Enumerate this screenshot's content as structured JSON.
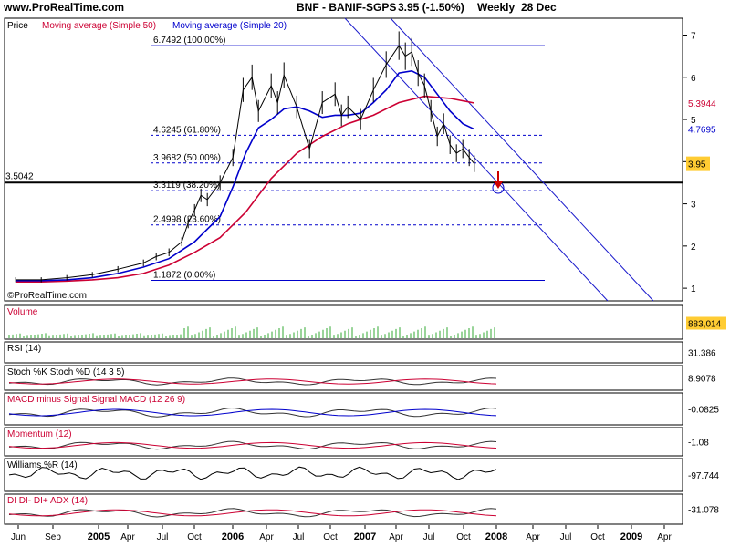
{
  "header": {
    "site": "www.ProRealTime.com",
    "instrument": "BNF - BANIF-SGPS",
    "quote": "3.95 (-1.50%)",
    "period": "Weekly",
    "date": "28 Dec"
  },
  "watermark": "©ProRealTime.com",
  "colors": {
    "price": "#000000",
    "ma50": "#cc0033",
    "ma20": "#0000cc",
    "trend": "#1a1acc",
    "volume": "#33aa33",
    "accent_label": "#ffcc33"
  },
  "chart_data": [
    {
      "type": "line",
      "title": "",
      "legend": [
        {
          "name": "Price",
          "color": "#000000"
        },
        {
          "name": "Moving average (Simple 50)",
          "color": "#cc0033"
        },
        {
          "name": "Moving average (Simple 20)",
          "color": "#0000cc"
        }
      ],
      "ylim": [
        0.7,
        7.4
      ],
      "y_ticks": [
        1,
        2,
        3,
        4,
        5,
        6,
        7
      ],
      "x_labels": [
        "Jun",
        "Sep",
        "2005",
        "Apr",
        "Jul",
        "Oct",
        "2006",
        "Apr",
        "Jul",
        "Oct",
        "2007",
        "Apr",
        "Jul",
        "Oct",
        "2008",
        "Apr",
        "Jul",
        "Oct",
        "2009",
        "Apr"
      ],
      "x_bold_labels": [
        "2005",
        "2006",
        "2007",
        "2008",
        "2009"
      ],
      "series": [
        {
          "name": "Price",
          "x": [
            2004.4,
            2004.6,
            2004.8,
            2005.0,
            2005.2,
            2005.4,
            2005.5,
            2005.6,
            2005.7,
            2005.75,
            2005.8,
            2005.85,
            2005.9,
            2006.0,
            2006.1,
            2006.18,
            2006.25,
            2006.3,
            2006.4,
            2006.45,
            2006.5,
            2006.6,
            2006.7,
            2006.8,
            2006.9,
            2006.95,
            2007.0,
            2007.1,
            2007.2,
            2007.3,
            2007.4,
            2007.45,
            2007.5,
            2007.55,
            2007.6,
            2007.65,
            2007.7,
            2007.75,
            2007.8,
            2007.85,
            2007.9,
            2007.95,
            2007.99
          ],
          "values": [
            1.2,
            1.2,
            1.25,
            1.32,
            1.45,
            1.6,
            1.75,
            1.85,
            2.1,
            2.55,
            2.85,
            3.2,
            3.1,
            3.5,
            4.1,
            5.7,
            6.0,
            5.2,
            5.8,
            5.4,
            6.05,
            5.3,
            4.3,
            5.4,
            5.6,
            5.1,
            5.3,
            5.0,
            5.7,
            6.3,
            6.75,
            6.5,
            6.6,
            6.1,
            5.8,
            5.2,
            4.6,
            4.9,
            4.4,
            4.2,
            4.3,
            4.1,
            3.95
          ]
        },
        {
          "name": "Moving average (Simple 20)",
          "x": [
            2004.4,
            2004.6,
            2004.8,
            2005.0,
            2005.2,
            2005.4,
            2005.6,
            2005.8,
            2006.0,
            2006.1,
            2006.2,
            2006.3,
            2006.4,
            2006.5,
            2006.6,
            2006.7,
            2006.8,
            2006.9,
            2007.0,
            2007.1,
            2007.2,
            2007.3,
            2007.4,
            2007.5,
            2007.6,
            2007.7,
            2007.8,
            2007.9,
            2007.99
          ],
          "values": [
            1.18,
            1.18,
            1.2,
            1.25,
            1.35,
            1.5,
            1.7,
            2.1,
            2.7,
            3.4,
            4.2,
            4.8,
            5.0,
            5.25,
            5.3,
            5.2,
            5.05,
            5.1,
            5.1,
            5.15,
            5.4,
            5.7,
            6.1,
            6.15,
            6.0,
            5.6,
            5.2,
            4.9,
            4.77
          ]
        },
        {
          "name": "Moving average (Simple 50)",
          "x": [
            2004.4,
            2004.6,
            2004.8,
            2005.0,
            2005.2,
            2005.4,
            2005.6,
            2005.8,
            2006.0,
            2006.2,
            2006.4,
            2006.6,
            2006.8,
            2007.0,
            2007.2,
            2007.4,
            2007.6,
            2007.8,
            2007.99
          ],
          "values": [
            1.15,
            1.15,
            1.17,
            1.2,
            1.25,
            1.35,
            1.55,
            1.85,
            2.2,
            2.8,
            3.6,
            4.2,
            4.6,
            4.9,
            5.1,
            5.4,
            5.55,
            5.5,
            5.39
          ]
        }
      ],
      "horizontal_line": {
        "label": "3.5042",
        "value": 3.5042
      },
      "fibonacci_levels": [
        {
          "label": "6.7492 (100.00%)",
          "value": 6.7492
        },
        {
          "label": "4.6245 (61.80%)",
          "value": 4.6245
        },
        {
          "label": "3.9682 (50.00%)",
          "value": 3.9682
        },
        {
          "label": "3.3119 (38.20%)",
          "value": 3.3119
        },
        {
          "label": "2.4998 (23.60%)",
          "value": 2.4998
        },
        {
          "label": "1.1872 (0.00%)",
          "value": 1.1872
        }
      ],
      "right_labels": [
        {
          "text": "5.3944",
          "value": 5.3944,
          "color": "#cc0033"
        },
        {
          "text": "4.7695",
          "value": 4.7695,
          "color": "#0000cc"
        },
        {
          "text": "3.95",
          "value": 3.95,
          "color": "#000000",
          "highlight": true
        }
      ]
    },
    {
      "type": "bar",
      "title": "Volume",
      "value_label": "883,014"
    },
    {
      "type": "line",
      "title": "RSI (14)",
      "value_label": "31.386"
    },
    {
      "type": "line",
      "title": "Stoch %K Stoch %D (14 3 5)",
      "value_label": "8.9078"
    },
    {
      "type": "line",
      "title": "MACD minus Signal Signal MACD (12 26 9)",
      "value_label": "-0.0825"
    },
    {
      "type": "line",
      "title": "Momentum (12)",
      "value_label": "-1.08"
    },
    {
      "type": "line",
      "title": "Williams %R (14)",
      "value_label": "-97.744"
    },
    {
      "type": "line",
      "title": "DI DI- DI+ ADX (14)",
      "value_label": "-31.078"
    }
  ]
}
